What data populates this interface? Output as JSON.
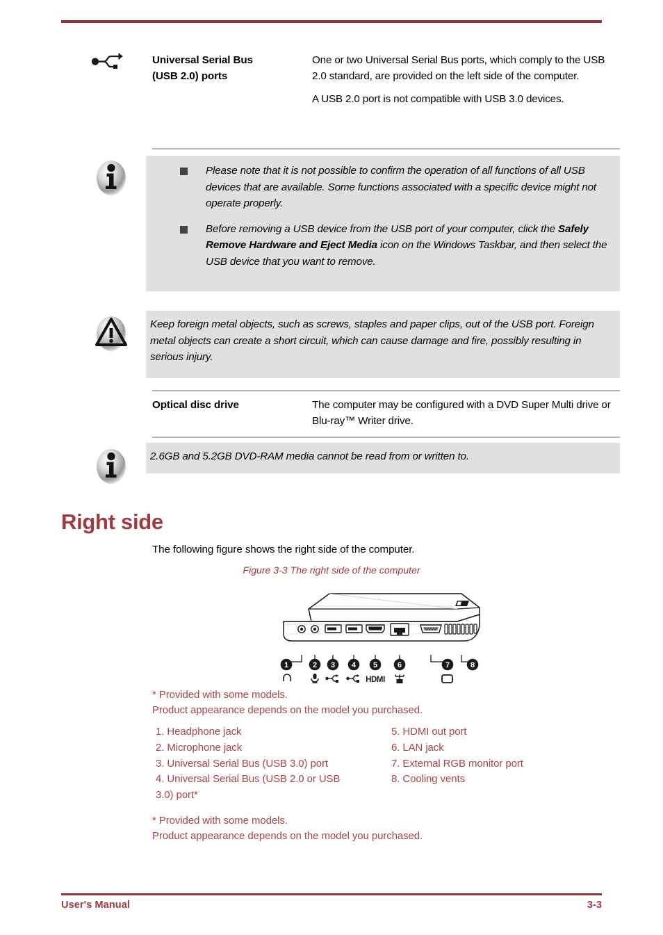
{
  "document": {
    "top_rule_color": "#93323a",
    "accent_color": "#a03a41"
  },
  "spec_table": {
    "rows": [
      {
        "icon": "usb-plus-icon",
        "term": "Universal Serial Bus\n(USB 2.0) ports",
        "term_line1": "Universal Serial Bus",
        "term_line2": "(USB 2.0) ports",
        "definition_1": "One or two Universal Serial Bus ports, which comply to the USB 2.0 standard, are provided on the left side of the computer.",
        "definition_2": "A USB 2.0 port is not compatible with USB 3.0 devices."
      },
      {
        "icon": "none",
        "term": "Optical disc drive",
        "definition_1": "The computer may be configured with a DVD Super Multi drive or Blu-ray™ Writer drive."
      }
    ]
  },
  "note_usb": {
    "icon": "info-icon",
    "items": [
      {
        "bullet": "square-bullet",
        "text_before": "Please note that it is not possible to confirm the operation of all functions of all USB devices that are available. Some functions associated with a specific device might not operate properly.",
        "bold": "",
        "text_after": ""
      },
      {
        "bullet": "square-bullet",
        "text_before": "Before removing a USB device from the USB port of your computer, click the ",
        "bold": "Safely Remove Hardware and Eject Media",
        "text_after": " icon on the Windows Taskbar, and then select the USB device that you want to remove."
      }
    ]
  },
  "caution_usb": {
    "icon": "warning-triangle-icon",
    "text": "Keep foreign metal objects, such as screws, staples and paper clips, out of the USB port. Foreign metal objects can create a short circuit, which can cause damage and fire, possibly resulting in serious injury."
  },
  "note_dvdram": {
    "icon": "info-icon",
    "text": "2.6GB and 5.2GB DVD-RAM media cannot be read from or written to."
  },
  "section": {
    "heading": "Right side",
    "intro": "The following figure shows the right side of the computer.",
    "figure_caption": "Figure 3-3 The right side of the computer"
  },
  "figure": {
    "name": "laptop-right-side-illustration",
    "callouts": [
      {
        "number": "1",
        "glyph": "headphone-icon"
      },
      {
        "number": "2",
        "glyph": "microphone-icon"
      },
      {
        "number": "3",
        "glyph": "usb-icon"
      },
      {
        "number": "4",
        "glyph": "usb-icon"
      },
      {
        "number": "5",
        "glyph": "hdmi-icon"
      },
      {
        "number": "6",
        "glyph": "lan-icon"
      },
      {
        "number": "7",
        "glyph": "monitor-icon"
      },
      {
        "number": "8",
        "glyph": "none"
      }
    ],
    "hdmi_label": "HDMI"
  },
  "figure_notes_top": {
    "line1": "* Provided with some models.",
    "line2": "Product appearance depends on the model you purchased."
  },
  "figure_notes_bottom": {
    "line1": "* Provided with some models.",
    "line2": "Product appearance depends on the model you purchased."
  },
  "legend": {
    "left_column": [
      "1. Headphone jack",
      "2. Microphone jack",
      "3. Universal Serial Bus (USB 3.0) port",
      "4. Universal Serial Bus (USB 2.0 or USB",
      "3.0) port*"
    ],
    "right_column": [
      "5. HDMI out port",
      "6. LAN jack",
      "7. External RGB monitor port",
      "8. Cooling vents"
    ]
  },
  "footer": {
    "left": "User's Manual",
    "right": "3-3"
  }
}
